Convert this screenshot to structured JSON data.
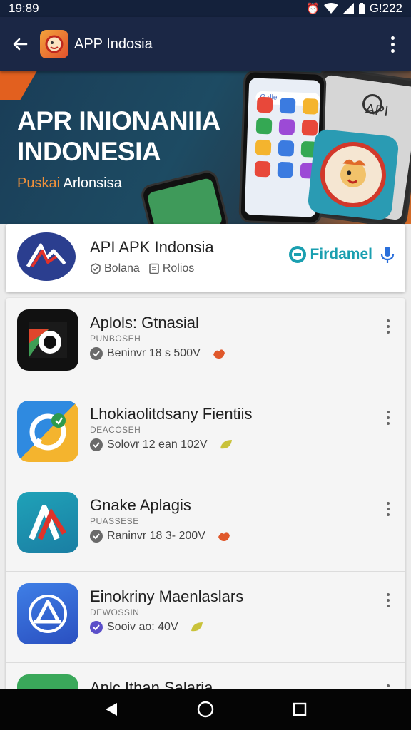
{
  "status_bar": {
    "time": "19:89",
    "right_text": "G!222"
  },
  "app_bar": {
    "title": "APP Indosia"
  },
  "banner": {
    "title_line1": "APR INIONANIIA",
    "title_line2": "INDONESIA",
    "sub_accent": "Puskai",
    "sub_rest": "Arlonsisa",
    "search_text": "G.dle",
    "right_phone_text": "API"
  },
  "featured": {
    "title": "API APK Indonsia",
    "meta1": "Bolana",
    "meta2": "Rolios",
    "brand": "Firdamel"
  },
  "apps": [
    {
      "title": "Aplols: Gtnasial",
      "publisher": "PUNBOSEH",
      "meta": "Beninvr 18  s  500V",
      "badge_color": "#e0582b",
      "check_color": "#6a6a6a",
      "icon": "circle-app-icon"
    },
    {
      "title": "Lhokiaolitdsany Fientiis",
      "publisher": "DEACOSEH",
      "meta": "Solovr 12 ean 102V",
      "badge_color": "#c9c23a",
      "check_color": "#6a6a6a",
      "icon": "chat-app-icon"
    },
    {
      "title": "Gnake Aplagis",
      "publisher": "PUASSESE",
      "meta": "Raninvr 18  3- 200V",
      "badge_color": "#e0582b",
      "check_color": "#6a6a6a",
      "icon": "triangle-app-icon"
    },
    {
      "title": "Einokriny Maenlaslars",
      "publisher": "DEWOSSIN",
      "meta": "Sooiv  ao: 40V",
      "badge_color": "#c9c23a",
      "check_color": "#5b4fc9",
      "icon": "store-app-icon"
    },
    {
      "title": "Anlc Ithan Salaria",
      "publisher": "",
      "meta": "",
      "badge_color": "",
      "check_color": "#6a6a6a",
      "icon": "green-app-icon"
    }
  ]
}
